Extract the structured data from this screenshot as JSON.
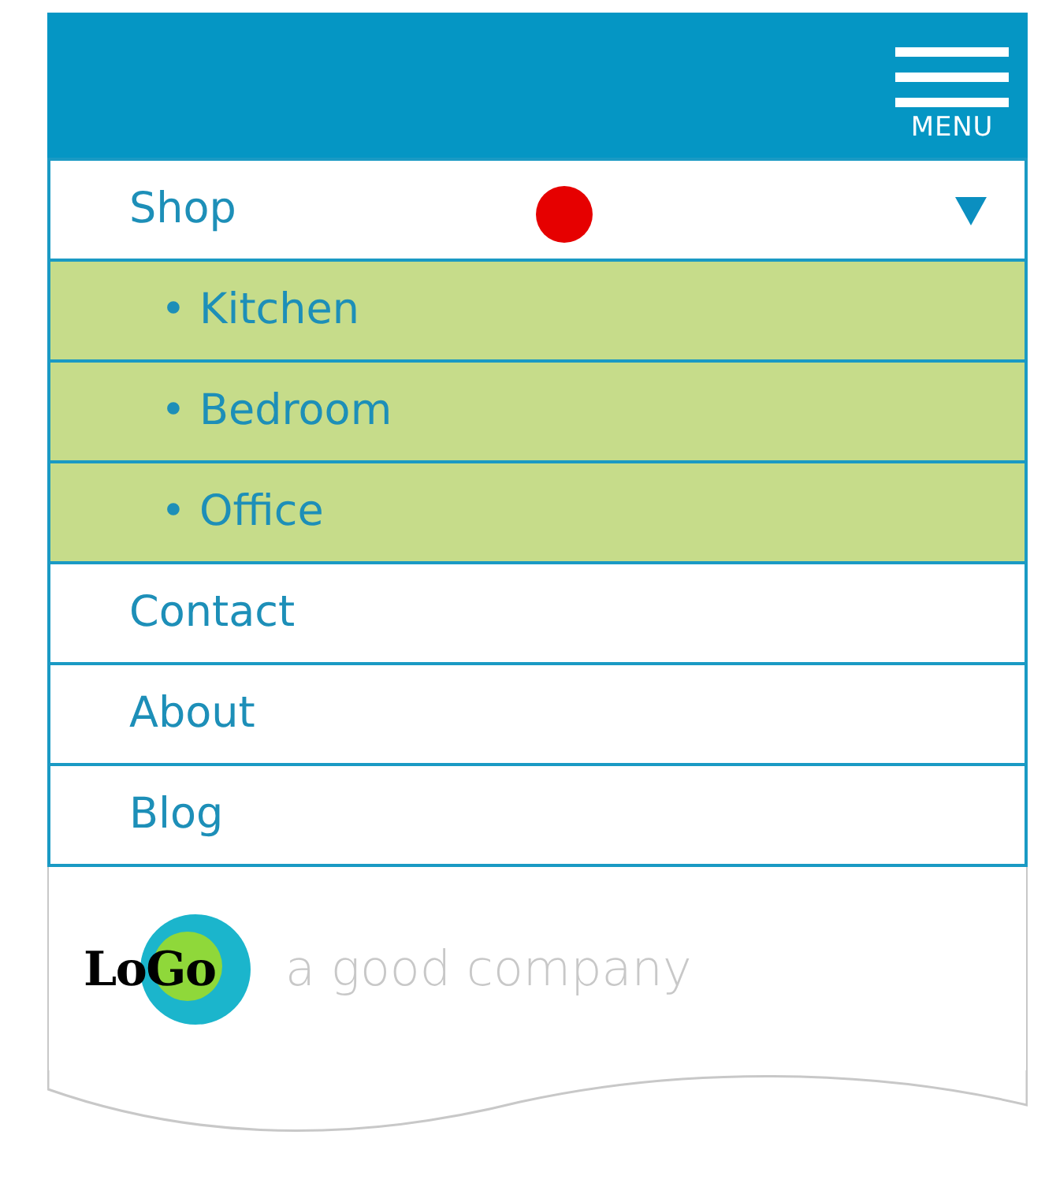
{
  "header": {
    "menu_label": "MENU"
  },
  "nav": [
    {
      "label": "Shop",
      "expanded": true,
      "children": [
        {
          "label": "• Kitchen"
        },
        {
          "label": "• Bedroom"
        },
        {
          "label": "• Office"
        }
      ]
    },
    {
      "label": "Contact"
    },
    {
      "label": "About"
    },
    {
      "label": "Blog"
    }
  ],
  "footer": {
    "logo": "LoGo",
    "tagline": "a good company"
  }
}
